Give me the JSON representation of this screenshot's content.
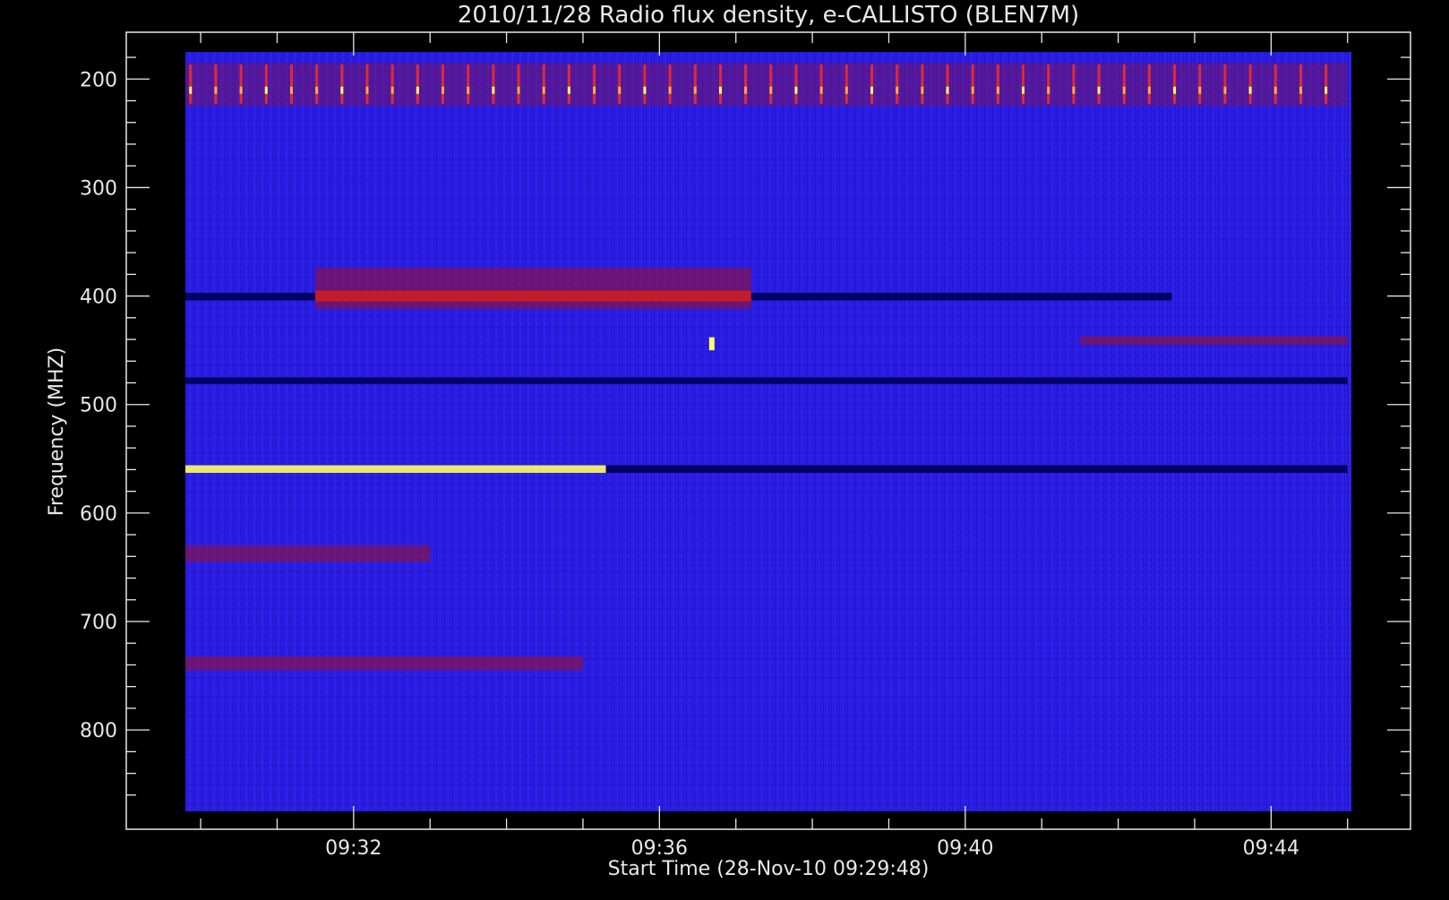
{
  "chart_data": {
    "type": "heatmap",
    "title": "2010/11/28  Radio flux density, e-CALLISTO (BLEN7M)",
    "xlabel": "Start Time (28-Nov-10 09:29:48)",
    "ylabel": "Frequency (MHZ)",
    "x_range": [
      "09:29:48",
      "09:45:03"
    ],
    "ylim": [
      175,
      875
    ],
    "y_inverted": true,
    "x_ticks": [
      {
        "label": "09:32",
        "minute": 32
      },
      {
        "label": "09:36",
        "minute": 36
      },
      {
        "label": "09:40",
        "minute": 40
      },
      {
        "label": "09:44",
        "minute": 44
      }
    ],
    "y_ticks": [
      200,
      300,
      400,
      500,
      600,
      700,
      800
    ],
    "colormap": {
      "background": "#2a1ee8",
      "low": "#000055",
      "mid": "#a01020",
      "high": "#ff3020",
      "peak": "#ffff60"
    },
    "features": [
      {
        "kind": "periodic-bursts",
        "freq_mhz": [
          185,
          225
        ],
        "start_min": 29.8,
        "end_min": 45.0,
        "period_min": 0.33,
        "intensity": "high"
      },
      {
        "kind": "band",
        "freq_mhz": [
          556,
          563
        ],
        "start_min": 29.8,
        "end_min": 35.3,
        "intensity": "peak"
      },
      {
        "kind": "band",
        "freq_mhz": [
          556,
          563
        ],
        "start_min": 35.3,
        "end_min": 45.0,
        "intensity": "low"
      },
      {
        "kind": "band",
        "freq_mhz": [
          395,
          405
        ],
        "start_min": 31.5,
        "end_min": 37.2,
        "intensity": "high"
      },
      {
        "kind": "band",
        "freq_mhz": [
          397,
          404
        ],
        "start_min": 29.8,
        "end_min": 31.5,
        "intensity": "low"
      },
      {
        "kind": "band",
        "freq_mhz": [
          397,
          404
        ],
        "start_min": 37.2,
        "end_min": 42.7,
        "intensity": "low"
      },
      {
        "kind": "band",
        "freq_mhz": [
          374,
          412
        ],
        "start_min": 31.5,
        "end_min": 37.2,
        "intensity": "mid"
      },
      {
        "kind": "band",
        "freq_mhz": [
          475,
          481
        ],
        "start_min": 29.8,
        "end_min": 45.0,
        "intensity": "low"
      },
      {
        "kind": "band",
        "freq_mhz": [
          437,
          445
        ],
        "start_min": 41.5,
        "end_min": 45.0,
        "intensity": "mid"
      },
      {
        "kind": "band",
        "freq_mhz": [
          732,
          745
        ],
        "start_min": 29.8,
        "end_min": 35.0,
        "intensity": "mid"
      },
      {
        "kind": "band",
        "freq_mhz": [
          630,
          645
        ],
        "start_min": 29.8,
        "end_min": 33.0,
        "intensity": "mid"
      },
      {
        "kind": "spot",
        "freq_mhz": [
          438,
          450
        ],
        "start_min": 36.65,
        "end_min": 36.72,
        "intensity": "peak"
      }
    ]
  }
}
